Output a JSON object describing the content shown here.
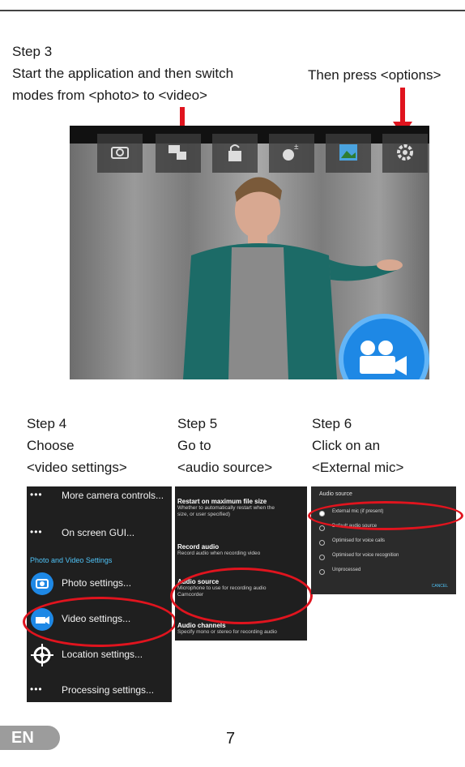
{
  "step3": {
    "title": "Step 3",
    "line1": "Start the application and then switch",
    "line2": "modes from <photo> to <video>",
    "right": "Then press <options>"
  },
  "step4": {
    "title": "Step 4",
    "line1": "Choose",
    "line2": "<video settings>"
  },
  "step5": {
    "title": "Step 5",
    "line1": "Go to",
    "line2": "<audio source>"
  },
  "step6": {
    "title": "Step 6",
    "line1": "Click on an",
    "line2": "<External mic>"
  },
  "panel4": {
    "items": [
      {
        "dots": "•••",
        "label": "More camera controls..."
      },
      {
        "dots": "•••",
        "label": "On screen GUI..."
      },
      {
        "label": "Photo settings..."
      },
      {
        "label": "Video settings..."
      },
      {
        "label": "Location settings..."
      },
      {
        "dots": "•••",
        "label": "Processing settings..."
      }
    ],
    "section": "Photo and Video Settings"
  },
  "panel5": {
    "items": [
      {
        "title": "Restart on maximum file size",
        "sub1": "Whether to automatically restart when the",
        "sub2": "size, or user specified)"
      },
      {
        "title": "Record audio",
        "sub1": "Record audio when recording video"
      },
      {
        "title": "Audio source",
        "sub1": "Microphone to use for recording audio",
        "sub2": "Camcorder"
      },
      {
        "title": "Audio channels",
        "sub1": "Specify mono or stereo for recording audio"
      }
    ]
  },
  "panel6": {
    "header": "Audio source",
    "options": [
      "External mic (if present)",
      "Default audio source",
      "Optimised for voice calls",
      "Optimised for voice recognition",
      "Unprocessed"
    ],
    "cancel": "CANCEL"
  },
  "footer": {
    "lang": "EN",
    "page": "7"
  },
  "colors": {
    "accent_red": "#e0141e",
    "accent_blue": "#4fc3f7"
  }
}
